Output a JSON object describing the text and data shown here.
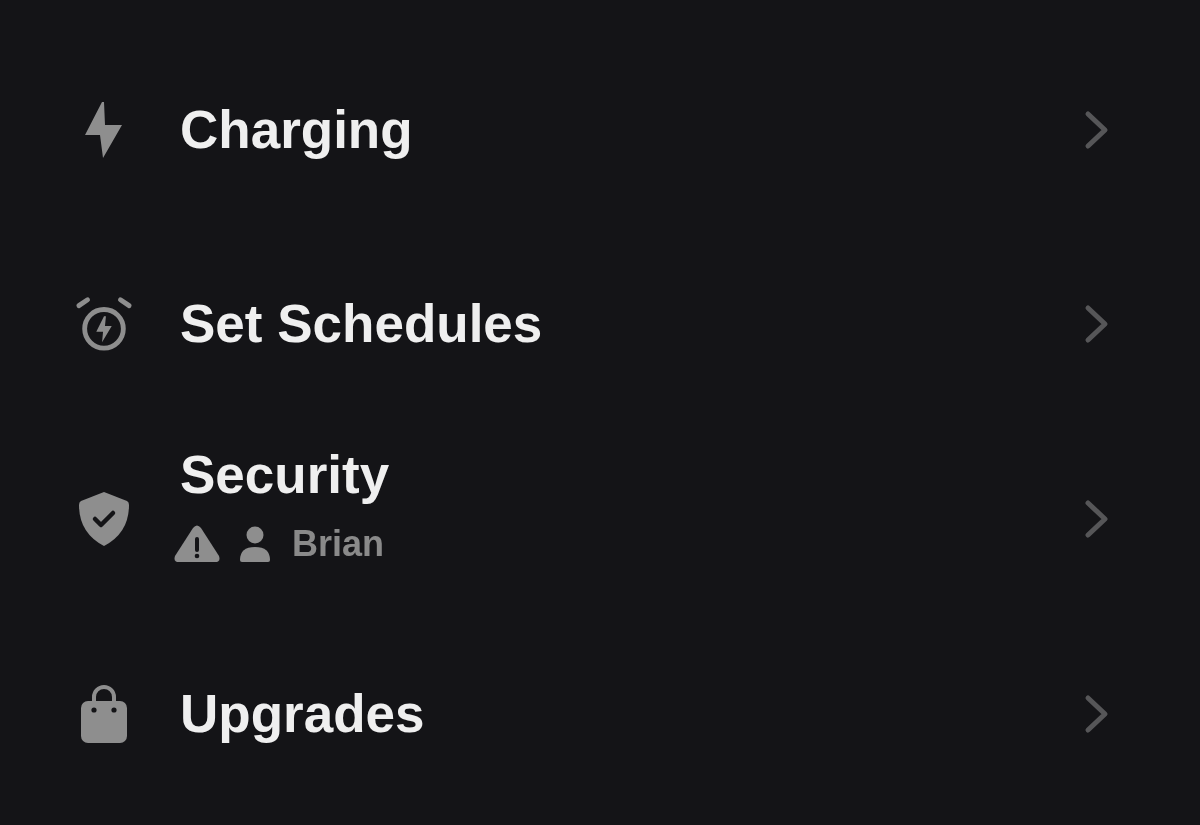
{
  "items": [
    {
      "label": "Charging"
    },
    {
      "label": "Set Schedules"
    },
    {
      "label": "Security",
      "user": "Brian"
    },
    {
      "label": "Upgrades"
    }
  ]
}
